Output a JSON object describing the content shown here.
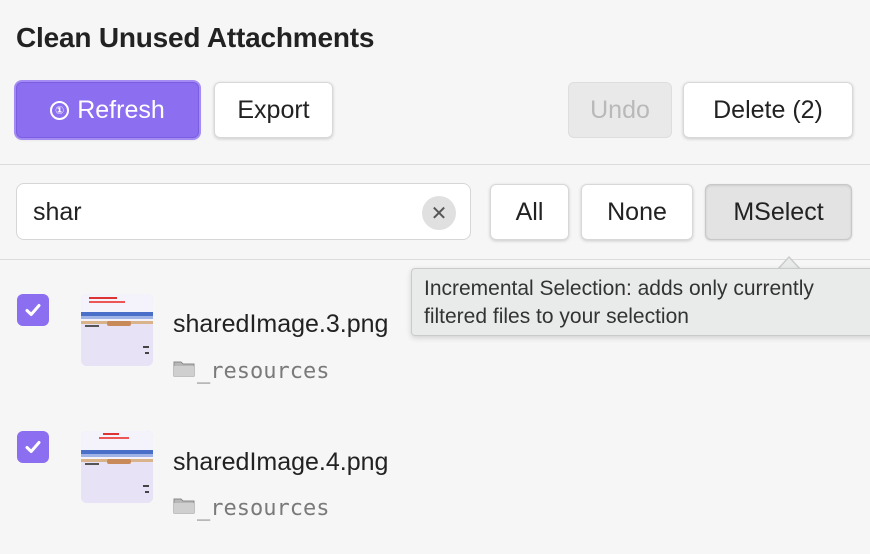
{
  "title": "Clean Unused Attachments",
  "toolbar": {
    "refresh_label": "Refresh",
    "refresh_icon_glyph": "①",
    "export_label": "Export",
    "undo_label": "Undo",
    "delete_label": "Delete (2)"
  },
  "filter": {
    "search_value": "shar",
    "clear_glyph": "✕",
    "all_label": "All",
    "none_label": "None",
    "mselect_label": "MSelect"
  },
  "tooltip": {
    "line1": "Incremental Selection: adds only currently",
    "line2": "filtered files to your selection"
  },
  "files": [
    {
      "name": "sharedImage.3.png",
      "folder": "_resources",
      "checked": true
    },
    {
      "name": "sharedImage.4.png",
      "folder": "_resources",
      "checked": true
    }
  ],
  "colors": {
    "accent": "#8c6ef0",
    "background": "#f6f6f6"
  }
}
